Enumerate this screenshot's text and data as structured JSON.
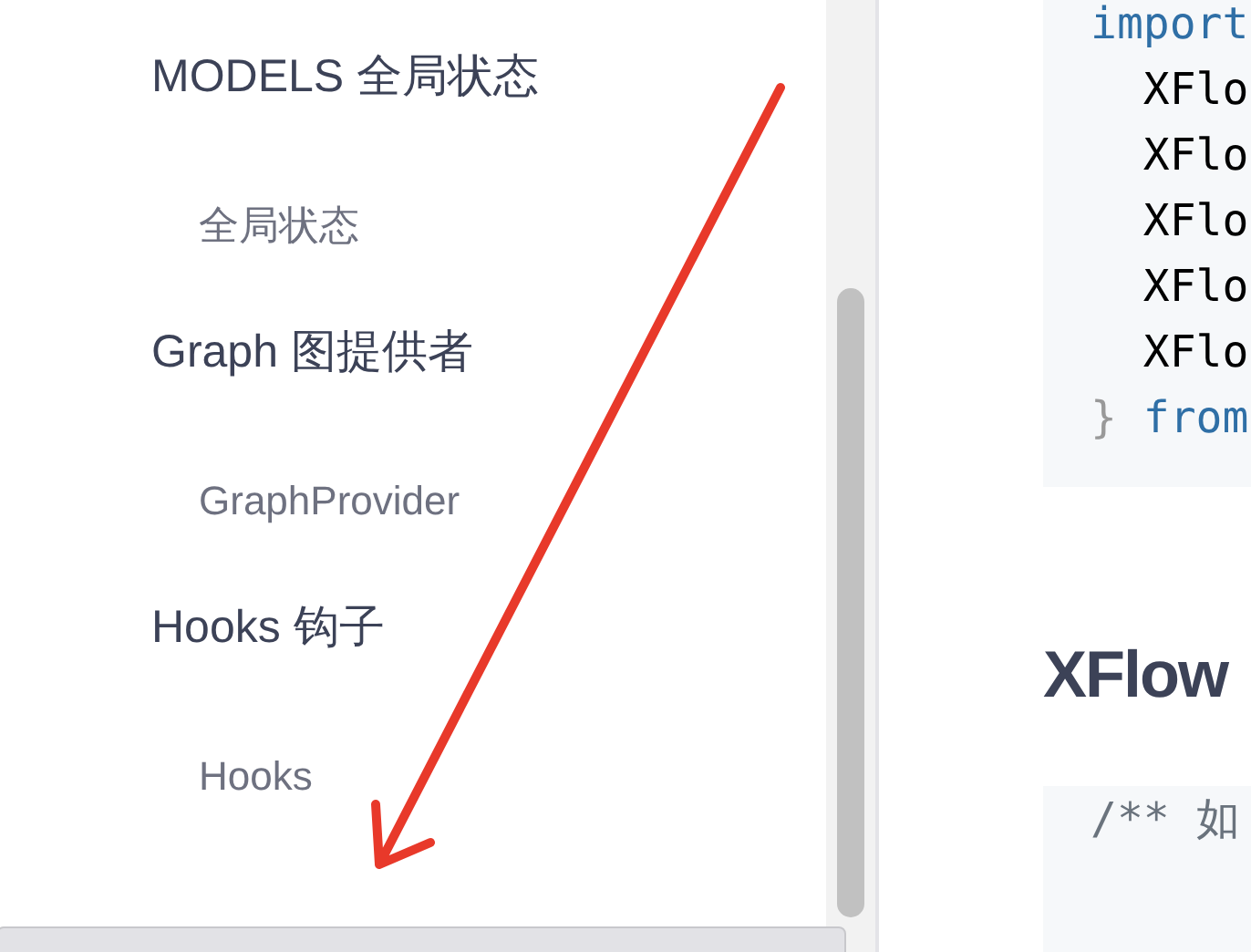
{
  "sidebar": {
    "groups": [
      {
        "title": "MODELS 全局状态",
        "items": [
          "全局状态"
        ]
      },
      {
        "title": "Graph 图提供者",
        "items": [
          "GraphProvider"
        ]
      },
      {
        "title": "Hooks 钩子",
        "items": [
          "Hooks"
        ]
      }
    ]
  },
  "content": {
    "code_blocks": [
      {
        "lines": [
          [
            {
              "text": "import",
              "kind": "keyword"
            }
          ],
          [
            {
              "text": "  XFlo",
              "kind": "plain"
            }
          ],
          [
            {
              "text": "  XFlo",
              "kind": "plain"
            }
          ],
          [
            {
              "text": "  XFlo",
              "kind": "plain"
            }
          ],
          [
            {
              "text": "  XFlo",
              "kind": "plain"
            }
          ],
          [
            {
              "text": "  XFlo",
              "kind": "plain"
            }
          ],
          [
            {
              "text": "}",
              "kind": "punct"
            },
            {
              "text": " from",
              "kind": "keyword"
            }
          ]
        ]
      }
    ],
    "heading": "XFlow",
    "code_block_2": {
      "lines": [
        [
          {
            "text": "/** 如",
            "kind": "comment"
          }
        ]
      ]
    }
  },
  "annotation": {
    "kind": "arrow",
    "color": "#e8392a"
  },
  "status_bar": {
    "visible": true
  }
}
